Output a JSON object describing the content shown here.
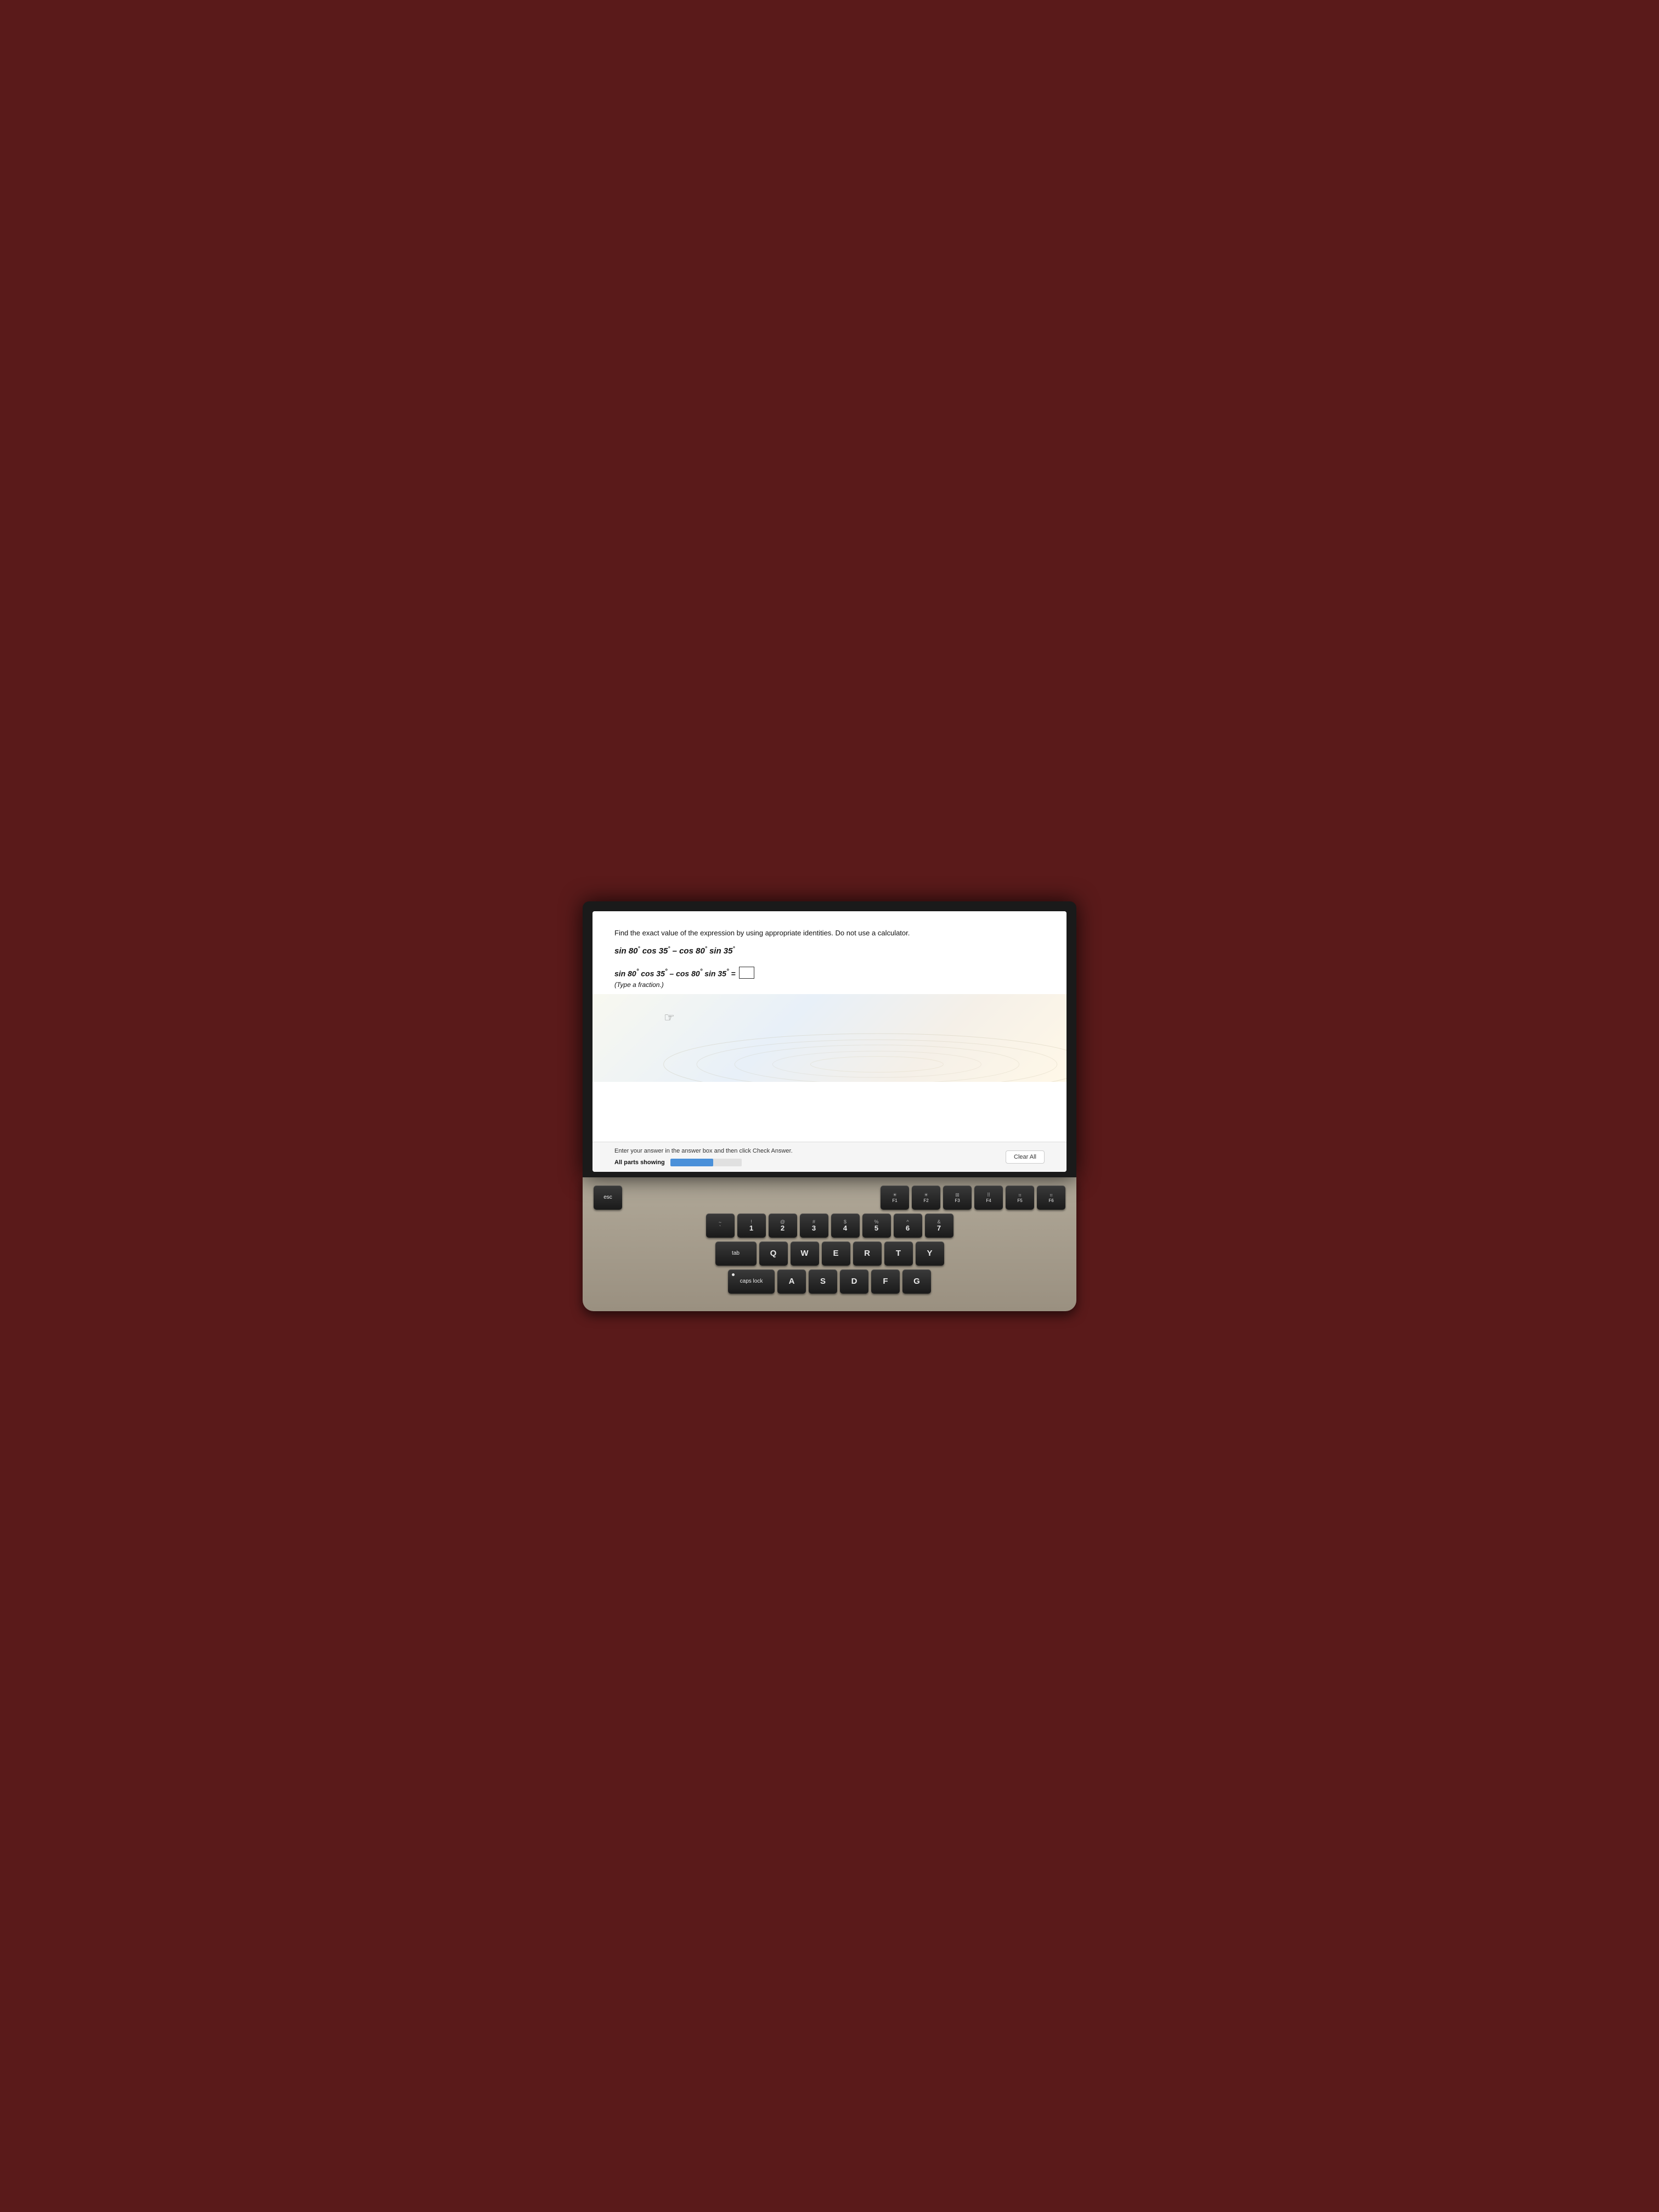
{
  "screen": {
    "question": {
      "instruction": "Find the exact value of the expression by using appropriate identities. Do not use a calculator.",
      "expression_display": "sin 80° cos 35° – cos 80° sin 35°",
      "equation_line": "sin 80° cos 35° – cos 80° sin 35° =",
      "hint": "(Type a fraction.)"
    },
    "bottom": {
      "instruction": "Enter your answer in the answer box and then click Check Answer.",
      "parts_label": "All parts showing",
      "clear_all": "Clear All"
    }
  },
  "keyboard": {
    "row_fn": [
      "esc",
      "F1",
      "F2",
      "F3",
      "F4",
      "F5",
      "F6"
    ],
    "row_numbers": [
      {
        "top": "~",
        "main": "`"
      },
      {
        "top": "!",
        "main": "1"
      },
      {
        "top": "@",
        "main": "2"
      },
      {
        "top": "#",
        "main": "3"
      },
      {
        "top": "$",
        "main": "4"
      },
      {
        "top": "%",
        "main": "5"
      },
      {
        "top": "^",
        "main": "6"
      },
      {
        "top": "&",
        "main": "7"
      }
    ],
    "row_qwerty": [
      "Q",
      "W",
      "E",
      "R",
      "T",
      "Y"
    ],
    "row_asdf": [
      "A",
      "S",
      "D",
      "F",
      "G"
    ],
    "tab_label": "tab",
    "caps_label": "caps lock"
  }
}
